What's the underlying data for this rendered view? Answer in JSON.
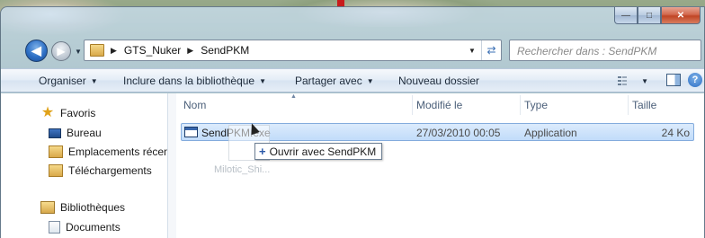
{
  "window": {
    "caption": {
      "minimize": "—",
      "maximize": "□",
      "close": "✕"
    }
  },
  "nav": {
    "back_glyph": "◀",
    "forward_glyph": "▶",
    "breadcrumb": [
      "GTS_Nuker",
      "SendPKM"
    ],
    "separator": "▶",
    "search_placeholder": "Rechercher dans : SendPKM"
  },
  "toolbar": {
    "organize": "Organiser",
    "include_library": "Inclure dans la bibliothèque",
    "share_with": "Partager avec",
    "new_folder": "Nouveau dossier"
  },
  "sidebar": {
    "items": [
      {
        "label": "Favoris",
        "icon": "star-icon"
      },
      {
        "label": "Bureau",
        "icon": "desktop-icon"
      },
      {
        "label": "Emplacements récents",
        "icon": "recent-places-icon"
      },
      {
        "label": "Téléchargements",
        "icon": "downloads-icon"
      },
      {
        "label": "Bibliothèques",
        "icon": "libraries-icon"
      },
      {
        "label": "Documents",
        "icon": "documents-icon"
      }
    ]
  },
  "columns": {
    "name": "Nom",
    "modified": "Modifié le",
    "type": "Type",
    "size": "Taille"
  },
  "files": [
    {
      "name": "SendPKM.exe",
      "modified": "27/03/2010 00:05",
      "type": "Application",
      "size": "24 Ko"
    }
  ],
  "drag": {
    "ghost_label": "Milotic_Shi...",
    "tooltip": "Ouvrir avec SendPKM",
    "tooltip_icon": "+"
  }
}
